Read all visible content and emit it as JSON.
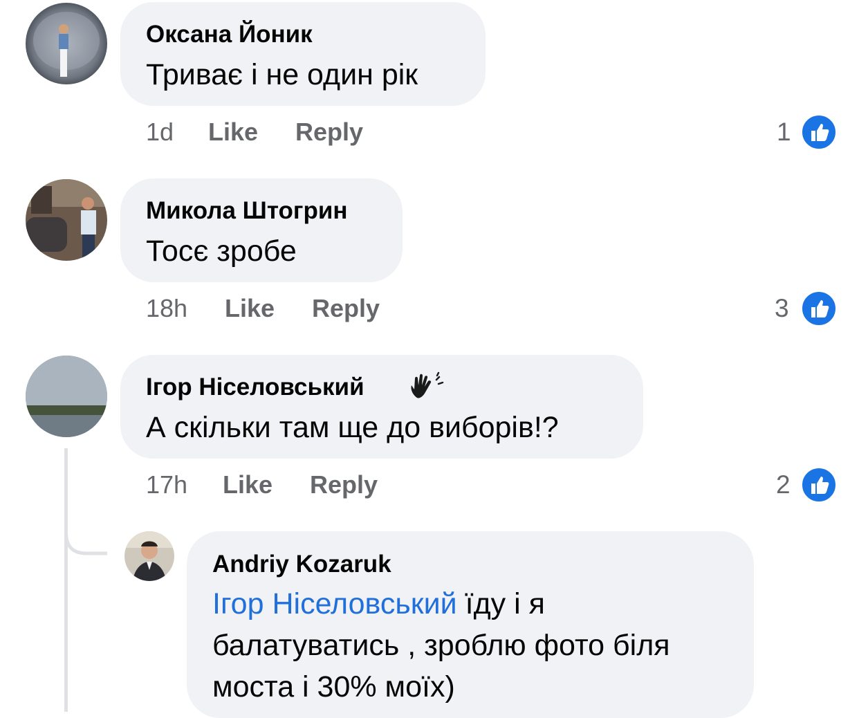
{
  "comments": [
    {
      "author": "Оксана Йоник",
      "text": "Триває і не один рік",
      "time": "1d",
      "like_label": "Like",
      "reply_label": "Reply",
      "reactions": "1",
      "reaction_icon": "thumbs-up-icon"
    },
    {
      "author": "Микола Штогрин",
      "text": "Тосє зробе",
      "time": "18h",
      "like_label": "Like",
      "reply_label": "Reply",
      "reactions": "3",
      "reaction_icon": "thumbs-up-icon"
    },
    {
      "author": "Ігор Ніселовський",
      "author_badge_icon": "waving-hand-icon",
      "text": "А скільки там ще до виборів!?",
      "time": "17h",
      "like_label": "Like",
      "reply_label": "Reply",
      "reactions": "2",
      "reaction_icon": "thumbs-up-icon"
    }
  ],
  "reply": {
    "author": "Andriy Kozaruk",
    "mention": "Ігор Ніселовський",
    "line1_rest": " їду і я",
    "line2": "балатуватись , зроблю фото біля",
    "line3": "моста і 30% моїх)"
  },
  "colors": {
    "bubble": "#f0f2f5",
    "link": "#216fdb",
    "reaction_blue": "#1b74e4",
    "meta_gray": "#65676b"
  }
}
